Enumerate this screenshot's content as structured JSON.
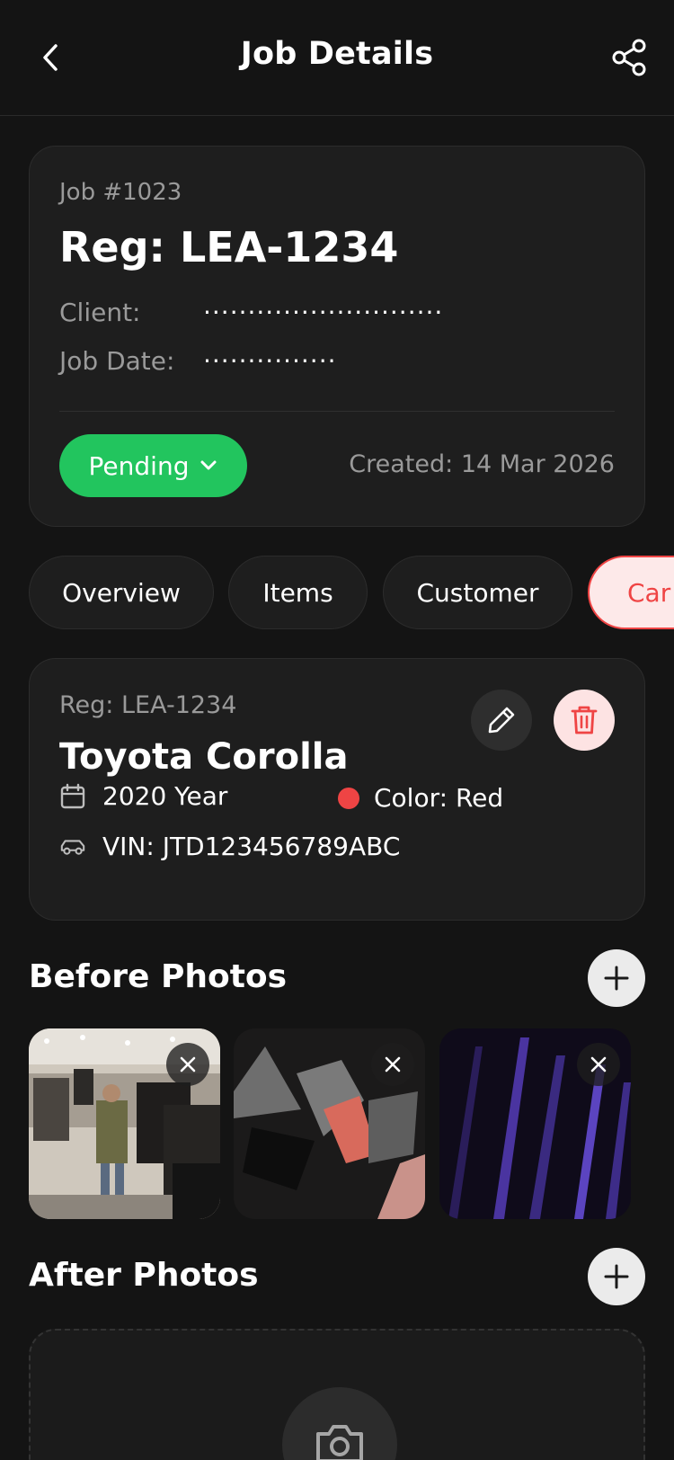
{
  "header": {
    "title": "Job Details",
    "back_icon": "chevron-left-icon",
    "share_icon": "share-icon"
  },
  "job": {
    "number": "Job #1023",
    "reg": "Reg: LEA-1234",
    "client_label": "Client:",
    "client_value": "...........................",
    "date_label": "Job Date:",
    "date_value": "...............",
    "status": "Pending",
    "status_color": "#22c55e",
    "created": "Created: 14 Mar 2026"
  },
  "tabs": [
    {
      "label": "Overview",
      "active": false
    },
    {
      "label": "Items",
      "active": false
    },
    {
      "label": "Customer",
      "active": false
    },
    {
      "label": "Car",
      "active": true
    }
  ],
  "vehicle": {
    "reg": "Reg: LEA-1234",
    "name": "Toyota Corolla",
    "year": "2020 Year",
    "color": "Color: Red",
    "color_swatch": "#ef4444",
    "vin": "VIN: JTD123456789ABC"
  },
  "before_photos": {
    "title": "Before Photos",
    "photos": [
      {
        "subject": "clothing-store-photo"
      },
      {
        "subject": "abstract-shapes-photo"
      },
      {
        "subject": "purple-lines-photo"
      }
    ]
  },
  "after_photos": {
    "title": "After Photos"
  },
  "colors": {
    "background": "#141414",
    "card": "#1e1e1e",
    "accent_red": "#ef4444",
    "success_green": "#22c55e"
  }
}
